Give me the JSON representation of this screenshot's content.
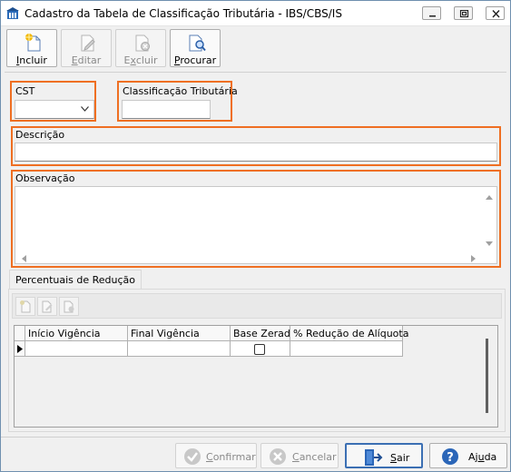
{
  "window": {
    "title": "Cadastro da Tabela de Classificação Tributária - IBS/CBS/IS"
  },
  "toolbar": {
    "incluir": {
      "pre": "",
      "key": "I",
      "post": "ncluir"
    },
    "editar": {
      "pre": "",
      "key": "E",
      "post": "ditar"
    },
    "excluir": {
      "pre": "E",
      "key": "x",
      "post": "cluir"
    },
    "procurar": {
      "pre": "",
      "key": "P",
      "post": "rocurar"
    }
  },
  "form": {
    "cst_label": "CST",
    "cst_value": "",
    "classificacao_label": "Classificação Tributária",
    "classificacao_value": "",
    "descricao_label": "Descrição",
    "descricao_value": "",
    "observacao_label": "Observação",
    "observacao_value": ""
  },
  "tabs": {
    "percentuais_label": "Percentuais de Redução"
  },
  "grid": {
    "columns": [
      "Início Vigência",
      "Final Vigência",
      "Base Zerada",
      "% Redução de Alíquota"
    ],
    "rows": [
      {
        "inicio": "",
        "final": "",
        "base_zerada": false,
        "reducao": ""
      }
    ]
  },
  "buttons": {
    "confirmar": {
      "pre": "",
      "key": "C",
      "post": "onfirmar"
    },
    "cancelar": {
      "pre": "",
      "key": "C",
      "post": "ancelar"
    },
    "sair": {
      "pre": "",
      "key": "S",
      "post": "air"
    },
    "ajuda": {
      "pre": "Aj",
      "key": "u",
      "post": "da"
    }
  },
  "colors": {
    "highlight": "#ef6f22",
    "default_button_border": "#3b6fb3"
  }
}
